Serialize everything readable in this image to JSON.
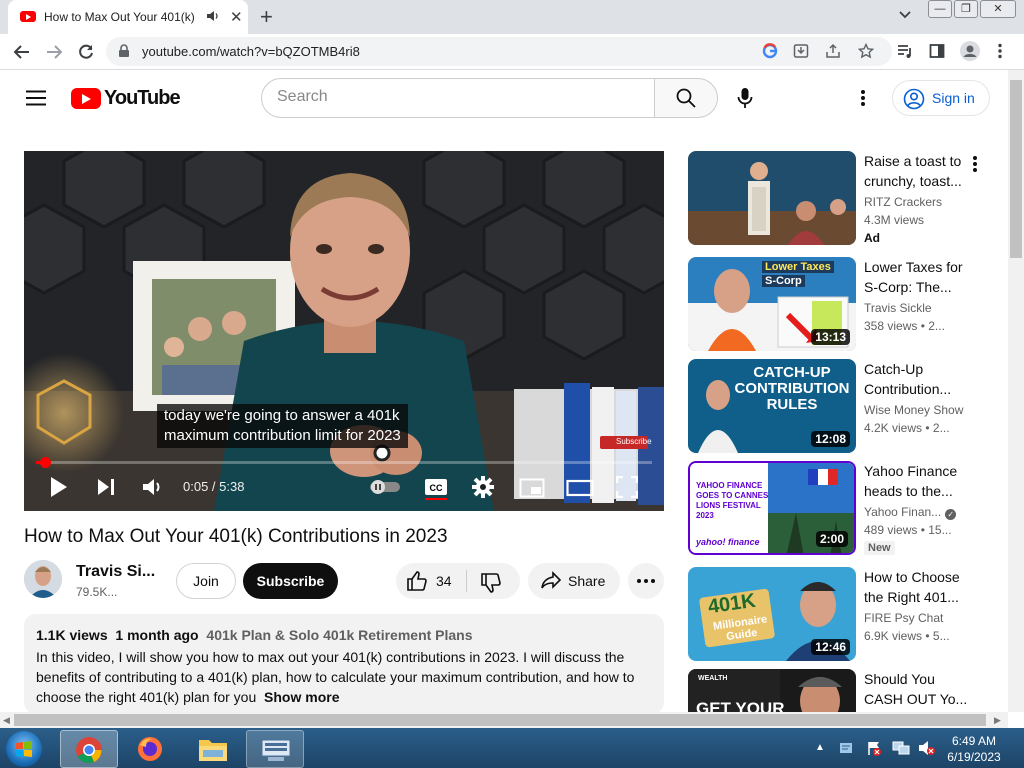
{
  "browser": {
    "tab_title": "How to Max Out Your 401(k)",
    "url": "youtube.com/watch?v=bQZOTMB4ri8"
  },
  "header": {
    "logo_text": "YouTube",
    "search_placeholder": "Search",
    "sign_in": "Sign in"
  },
  "player": {
    "caption_line1": "today we're going to answer a 401k",
    "caption_line2": "maximum contribution limit for 2023",
    "time": "0:05 / 5:38",
    "progress": 0.015,
    "overlay_subscribe": "Subscribe"
  },
  "video": {
    "title": "How to Max Out Your 401(k) Contributions in 2023",
    "channel": "Travis Si...",
    "subscribers": "79.5K...",
    "join": "Join",
    "subscribe": "Subscribe",
    "likes": "34",
    "share": "Share"
  },
  "description": {
    "views": "1.1K views",
    "age": "1 month ago",
    "tags": "401k Plan & Solo 401k Retirement Plans",
    "text": "In this video, I will show you how to max out your 401(k) contributions in 2023. I will discuss the benefits of contributing to a 401(k) plan, how to calculate your maximum contribution, and how to choose the right 401(k) plan for you",
    "show_more": "Show more"
  },
  "recommendations": [
    {
      "title": "Raise a toast to crunchy, toast...",
      "channel": "RITZ Crackers",
      "views": "4.3M views",
      "badge": "Ad",
      "duration": ""
    },
    {
      "title": "Lower Taxes for S-Corp: The...",
      "channel": "Travis Sickle",
      "views": "358 views • 2...",
      "badge": "",
      "duration": "13:13",
      "thumb_text1": "Lower Taxes",
      "thumb_text2": "S-Corp"
    },
    {
      "title": "Catch-Up Contribution...",
      "channel": "Wise Money Show",
      "views": "4.2K views • 2...",
      "badge": "",
      "duration": "12:08",
      "thumb_text1": "CATCH-UP",
      "thumb_text2": "CONTRIBUTION",
      "thumb_text3": "RULES"
    },
    {
      "title": "Yahoo Finance heads to the...",
      "channel": "Yahoo Finan...",
      "views": "489 views • 15...",
      "badge": "New",
      "duration": "2:00",
      "thumb_text1": "YAHOO FINANCE GOES TO CANNES LIONS FESTIVAL 2023",
      "thumb_text2": "yahoo! finance"
    },
    {
      "title": "How to Choose the Right 401...",
      "channel": "FIRE Psy Chat",
      "views": "6.9K views • 5...",
      "badge": "",
      "duration": "12:46",
      "thumb_text1": "401K",
      "thumb_text2": "Millionaire Guide"
    },
    {
      "title": "Should You CASH OUT Yo...",
      "channel": "",
      "views": "",
      "badge": "",
      "duration": "",
      "thumb_text1": "WEALTH",
      "thumb_text2": "GET YOUR"
    }
  ],
  "taskbar": {
    "time": "6:49 AM",
    "date": "6/19/2023"
  }
}
